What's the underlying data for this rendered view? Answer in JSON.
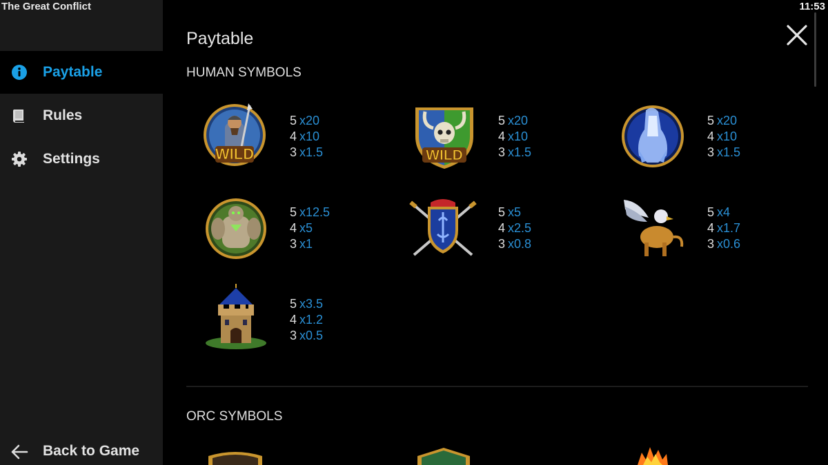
{
  "app": {
    "title": "The Great Conflict",
    "clock": "11:53"
  },
  "sidebar": {
    "items": [
      {
        "label": "Paytable",
        "icon": "info-icon",
        "active": true
      },
      {
        "label": "Rules",
        "icon": "book-icon",
        "active": false
      },
      {
        "label": "Settings",
        "icon": "gear-icon",
        "active": false
      }
    ],
    "back_label": "Back to Game",
    "back_icon": "arrow-left-icon"
  },
  "main": {
    "title": "Paytable",
    "close_icon": "close-icon",
    "sections": [
      {
        "heading": "HUMAN SYMBOLS",
        "symbols": [
          {
            "name": "knight-wild-symbol",
            "pays": [
              {
                "count": "5",
                "mult": "x20"
              },
              {
                "count": "4",
                "mult": "x10"
              },
              {
                "count": "3",
                "mult": "x1.5"
              }
            ],
            "wild_text": "WILD"
          },
          {
            "name": "skull-shield-wild-symbol",
            "pays": [
              {
                "count": "5",
                "mult": "x20"
              },
              {
                "count": "4",
                "mult": "x10"
              },
              {
                "count": "3",
                "mult": "x1.5"
              }
            ],
            "wild_text": "WILD"
          },
          {
            "name": "ice-spirit-symbol",
            "pays": [
              {
                "count": "5",
                "mult": "x20"
              },
              {
                "count": "4",
                "mult": "x10"
              },
              {
                "count": "3",
                "mult": "x1.5"
              }
            ]
          },
          {
            "name": "golem-symbol",
            "pays": [
              {
                "count": "5",
                "mult": "x12.5"
              },
              {
                "count": "4",
                "mult": "x5"
              },
              {
                "count": "3",
                "mult": "x1"
              }
            ]
          },
          {
            "name": "crest-shield-symbol",
            "pays": [
              {
                "count": "5",
                "mult": "x5"
              },
              {
                "count": "4",
                "mult": "x2.5"
              },
              {
                "count": "3",
                "mult": "x0.8"
              }
            ]
          },
          {
            "name": "griffin-symbol",
            "pays": [
              {
                "count": "5",
                "mult": "x4"
              },
              {
                "count": "4",
                "mult": "x1.7"
              },
              {
                "count": "3",
                "mult": "x0.6"
              }
            ]
          },
          {
            "name": "castle-tower-symbol",
            "pays": [
              {
                "count": "5",
                "mult": "x3.5"
              },
              {
                "count": "4",
                "mult": "x1.2"
              },
              {
                "count": "3",
                "mult": "x0.5"
              }
            ]
          }
        ]
      },
      {
        "heading": "ORC SYMBOLS"
      }
    ]
  },
  "colors": {
    "accent": "#1aa0e6",
    "multiplier": "#2a8fd4",
    "sidebar_bg": "#1a1a1a",
    "content_bg": "#000000"
  }
}
